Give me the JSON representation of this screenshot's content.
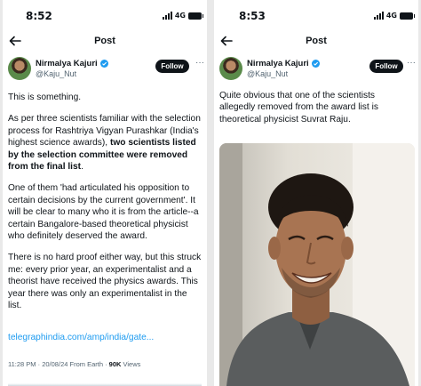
{
  "left": {
    "status": {
      "time": "8:52",
      "network": "4G"
    },
    "nav": {
      "title": "Post"
    },
    "author": {
      "name": "Nirmalya Kajuri",
      "handle": "@Kaju_Nut"
    },
    "follow_label": "Follow",
    "more_label": "···",
    "paragraphs": {
      "p1": "This is something.",
      "p2a": "As per three scientists familiar with the selection process for Rashtriya Vigyan Purashkar (India's highest science awards), ",
      "p2b": "two scientists listed by the selection committee were removed from the final list",
      "p2c": ".",
      "p3": "One of them 'had articulated his opposition to certain decisions by the current government'. It will be clear to many who it is from the article--a certain Bangalore-based theoretical physicist who definitely deserved the award.",
      "p4": "There is no hard proof either way, but this struck me: every prior year, an experimentalist and a theorist have received the physics awards. This year there was only an experimentalist in the list."
    },
    "link": "telegraphindia.com/amp/india/gate...",
    "meta": {
      "time_date": "11:28 PM · 20/08/24 From Earth · ",
      "views_count": "90K",
      "views_label": " Views"
    }
  },
  "right": {
    "status": {
      "time": "8:53",
      "network": "4G"
    },
    "nav": {
      "title": "Post"
    },
    "author": {
      "name": "Nirmalya Kajuri",
      "handle": "@Kaju_Nut"
    },
    "follow_label": "Follow",
    "more_label": "···",
    "text": "Quite obvious that one of the scientists allegedly removed from the award list is theoretical physicist Suvrat Raju."
  },
  "colors": {
    "accent": "#1d9bf0",
    "text": "#0f1419",
    "secondary": "#536471",
    "button": "#0f1419"
  },
  "icons": [
    "back-arrow-icon",
    "verified-icon",
    "more-icon",
    "signal-icon",
    "battery-icon",
    "bell-mute-icon"
  ]
}
